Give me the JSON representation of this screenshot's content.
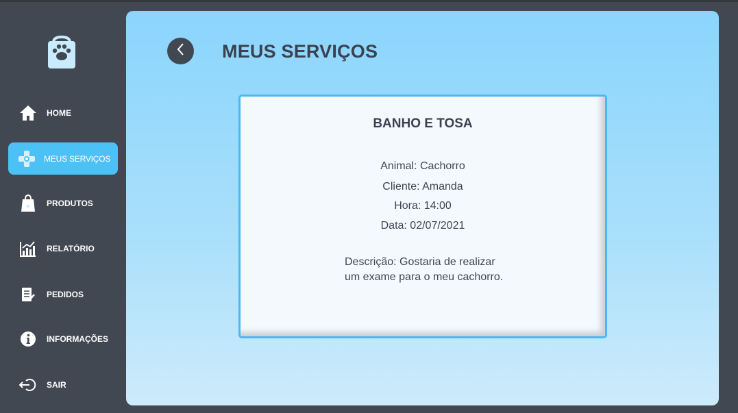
{
  "sidebar": {
    "logo_icon": "paw-bag-icon",
    "items": [
      {
        "label": "HOME",
        "icon": "home-icon",
        "active": false
      },
      {
        "label": "MEUS SERVIÇOS",
        "icon": "services-icon",
        "active": true
      },
      {
        "label": "PRODUTOS",
        "icon": "shopping-bag-icon",
        "active": false
      },
      {
        "label": "RELATÓRIO",
        "icon": "chart-icon",
        "active": false
      },
      {
        "label": "PEDIDOS",
        "icon": "clipboard-icon",
        "active": false
      },
      {
        "label": "INFORMAÇÕES",
        "icon": "info-icon",
        "active": false
      },
      {
        "label": "SAIR",
        "icon": "logout-icon",
        "active": false
      }
    ]
  },
  "header": {
    "title": "MEUS SERVIÇOS",
    "back_icon": "chevron-left-icon"
  },
  "service_card": {
    "title": "BANHO E TOSA",
    "animal": "Animal: Cachorro",
    "client": "Cliente: Amanda",
    "time": "Hora: 14:00",
    "date": "Data: 02/07/2021",
    "description_line1": "Descrição: Gostaria de realizar",
    "description_line2": "um exame para o meu cachorro."
  },
  "colors": {
    "sidebar_bg": "#424852",
    "active_item": "#4cc1f5",
    "card_border": "#4ab9ef",
    "text_dark": "#3a4250"
  }
}
